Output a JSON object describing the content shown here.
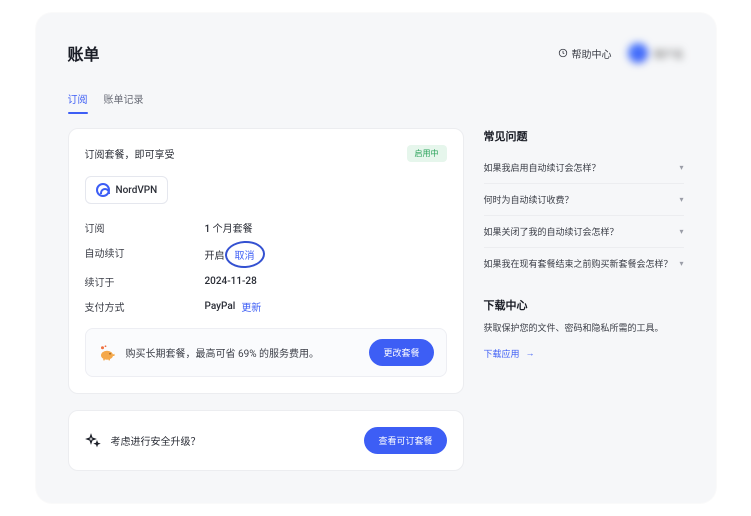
{
  "header": {
    "title": "账单",
    "help_label": "帮助中心",
    "user_name": "用户名"
  },
  "tabs": {
    "subscription": "订阅",
    "billing_history": "账单记录"
  },
  "subscription": {
    "heading": "订阅套餐，即可享受",
    "status_badge": "启用中",
    "product_name": "NordVPN",
    "rows": {
      "sub_label": "订阅",
      "sub_value": "1 个月套餐",
      "auto_label": "自动续订",
      "auto_value": "开启",
      "auto_action": "取消",
      "renew_label": "续订于",
      "renew_value": "2024-11-28",
      "pay_label": "支付方式",
      "pay_value": "PayPal",
      "pay_action": "更新"
    },
    "promo_text": "购买长期套餐，最高可省 69% 的服务费用。",
    "promo_cta": "更改套餐"
  },
  "upgrade": {
    "text": "考虑进行安全升级？",
    "cta": "查看可订套餐"
  },
  "faq": {
    "title": "常见问题",
    "items": [
      "如果我启用自动续订会怎样？",
      "何时为自动续订收费？",
      "如果关闭了我的自动续订会怎样？",
      "如果我在现有套餐结束之前购买新套餐会怎样？"
    ]
  },
  "downloads": {
    "title": "下载中心",
    "desc": "获取保护您的文件、密码和隐私所需的工具。",
    "link": "下载应用"
  }
}
